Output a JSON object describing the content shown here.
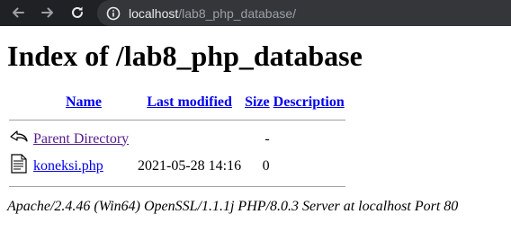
{
  "browser": {
    "url_host": "localhost",
    "url_path": "/lab8_php_database/"
  },
  "page": {
    "title": "Index of /lab8_php_database",
    "headers": {
      "name": "Name",
      "last_modified": "Last modified",
      "size": "Size",
      "description": "Description"
    },
    "rows": [
      {
        "icon": "back-arrow-icon",
        "name": "Parent Directory",
        "last_modified": "",
        "size": "-",
        "description": ""
      },
      {
        "icon": "text-file-icon",
        "name": "koneksi.php",
        "last_modified": "2021-05-28 14:16",
        "size": "0",
        "description": ""
      }
    ],
    "address": "Apache/2.4.46 (Win64) OpenSSL/1.1.1j PHP/8.0.3 Server at localhost Port 80"
  }
}
